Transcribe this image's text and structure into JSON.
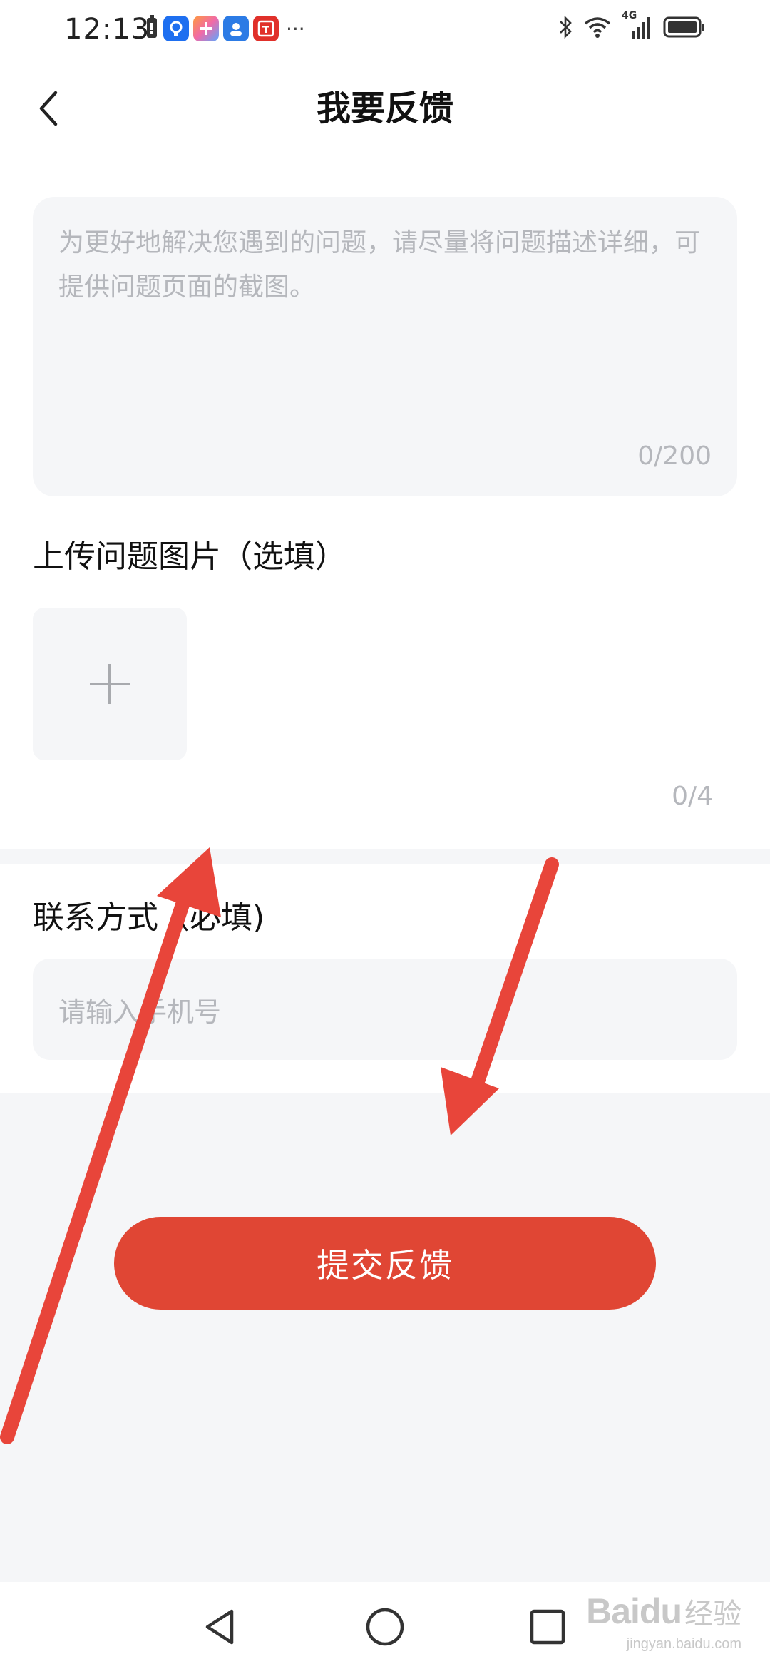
{
  "status_bar": {
    "time": "12:13",
    "more": "···",
    "signal_label": "4G"
  },
  "app_icons": [
    {
      "name": "bulb-app-icon",
      "color": "#1e6ff0",
      "glyph": "♀"
    },
    {
      "name": "plus-app-icon",
      "color": "#f07aa8",
      "glyph": "+"
    },
    {
      "name": "profile-app-icon",
      "color": "#2c7be5",
      "glyph": "◉"
    },
    {
      "name": "taobao-app-icon",
      "color": "#e0302a",
      "glyph": "淘"
    }
  ],
  "nav": {
    "title": "我要反馈"
  },
  "feedback": {
    "placeholder": "为更好地解决您遇到的问题，请尽量将问题描述详细，可提供问题页面的截图。",
    "counter": "0/200"
  },
  "upload": {
    "label": "上传问题图片（选填）",
    "counter": "0/4"
  },
  "contact": {
    "label": "联系方式（必填)",
    "placeholder": "请输入手机号"
  },
  "submit": {
    "label": "提交反馈"
  },
  "watermark": {
    "logo": "Baidu",
    "text": "经验",
    "sub": "jingyan.baidu.com"
  },
  "colors": {
    "accent": "#e04634",
    "field_bg": "#f5f6f8",
    "placeholder": "#b5b7bc",
    "annotation_arrow": "#e8453a"
  }
}
